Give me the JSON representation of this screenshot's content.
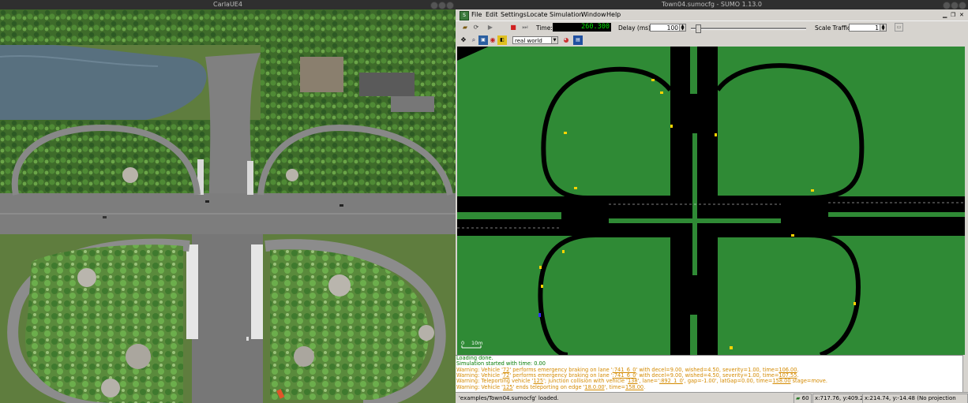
{
  "carla": {
    "title": "CarlaUE4"
  },
  "sumo": {
    "title": "Town04.sumocfg - SUMO 1.13.0",
    "menu": [
      "File",
      "Edit",
      "Settings",
      "Locate",
      "Simulation",
      "Window",
      "Help"
    ],
    "toolbar": {
      "time_label": "Time:",
      "time_value": "260.300",
      "delay_label": "Delay (ms):",
      "delay_value": "100",
      "scale_label": "Scale Traffic:",
      "scale_value": "1"
    },
    "view_scheme": "real world",
    "scale_label": "10m",
    "scale_zero": "0",
    "log": {
      "l1": "Loading done.",
      "l2": "Simulation started with time: 0.00",
      "l3a": "Warning: Vehicle '",
      "l3v": "72",
      "l3b": "' performs emergency braking on lane '",
      "l3l": ":741_6_0",
      "l3c": "' with decel=9.00, wished=4.50, severity=1.00, time=",
      "l3t": "106.00",
      "l3d": ".",
      "l4a": "Warning: Vehicle '",
      "l4v": "72",
      "l4b": "' performs emergency braking on lane '",
      "l4l": ":741_6_0",
      "l4c": "' with decel=9.00, wished=4.50, severity=1.00, time=",
      "l4t": "107.55",
      "l4d": ".",
      "l5a": "Warning: Teleporting vehicle '",
      "l5v": "125",
      "l5b": "'; junction collision with vehicle '",
      "l5w": "138",
      "l5c": "', lane='",
      "l5l": ":892_1_0",
      "l5d": "', gap=-1.00', latGap=0.00, time=",
      "l5t": "158.00",
      "l5e": " stage=move.",
      "l6a": "Warning: Vehicle '",
      "l6v": "125",
      "l6b": "' ends teleporting on edge '",
      "l6l": "18.0.00",
      "l6c": "', time=",
      "l6t": "158.00",
      "l6d": "."
    },
    "status": {
      "message": "'examples/Town04.sumocfg' loaded.",
      "fps": "60",
      "coords1": "x:717.76, y:409.28",
      "coords2": "x:214.74, y:-14.48 (No projection defined)"
    }
  }
}
